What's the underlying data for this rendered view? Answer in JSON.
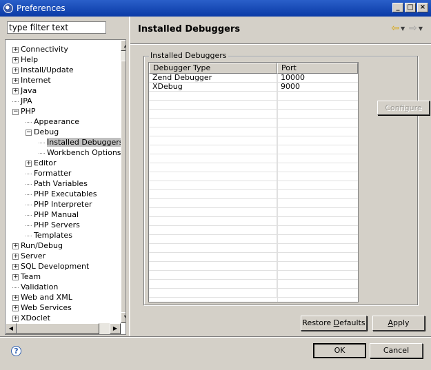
{
  "window": {
    "title": "Preferences"
  },
  "filter": {
    "value": "type filter text"
  },
  "tree": [
    {
      "label": "Connectivity",
      "expander": "+",
      "indent": 0
    },
    {
      "label": "Help",
      "expander": "+",
      "indent": 0
    },
    {
      "label": "Install/Update",
      "expander": "+",
      "indent": 0
    },
    {
      "label": "Internet",
      "expander": "+",
      "indent": 0
    },
    {
      "label": "Java",
      "expander": "+",
      "indent": 0
    },
    {
      "label": "JPA",
      "expander": "",
      "indent": 0
    },
    {
      "label": "PHP",
      "expander": "-",
      "indent": 0
    },
    {
      "label": "Appearance",
      "expander": "",
      "indent": 1
    },
    {
      "label": "Debug",
      "expander": "-",
      "indent": 1
    },
    {
      "label": "Installed Debuggers",
      "expander": "",
      "indent": 2,
      "selected": true
    },
    {
      "label": "Workbench Options",
      "expander": "",
      "indent": 2
    },
    {
      "label": "Editor",
      "expander": "+",
      "indent": 1
    },
    {
      "label": "Formatter",
      "expander": "",
      "indent": 1
    },
    {
      "label": "Path Variables",
      "expander": "",
      "indent": 1
    },
    {
      "label": "PHP Executables",
      "expander": "",
      "indent": 1
    },
    {
      "label": "PHP Interpreter",
      "expander": "",
      "indent": 1
    },
    {
      "label": "PHP Manual",
      "expander": "",
      "indent": 1
    },
    {
      "label": "PHP Servers",
      "expander": "",
      "indent": 1
    },
    {
      "label": "Templates",
      "expander": "",
      "indent": 1
    },
    {
      "label": "Run/Debug",
      "expander": "+",
      "indent": 0
    },
    {
      "label": "Server",
      "expander": "+",
      "indent": 0
    },
    {
      "label": "SQL Development",
      "expander": "+",
      "indent": 0
    },
    {
      "label": "Team",
      "expander": "+",
      "indent": 0
    },
    {
      "label": "Validation",
      "expander": "",
      "indent": 0
    },
    {
      "label": "Web and XML",
      "expander": "+",
      "indent": 0
    },
    {
      "label": "Web Services",
      "expander": "+",
      "indent": 0
    },
    {
      "label": "XDoclet",
      "expander": "+",
      "indent": 0
    }
  ],
  "page": {
    "title": "Installed Debuggers"
  },
  "group": {
    "legend": "Installed Debuggers"
  },
  "table": {
    "headers": [
      "Debugger Type",
      "Port"
    ],
    "rows": [
      [
        "Zend Debugger",
        "10000"
      ],
      [
        "XDebug",
        "9000"
      ]
    ],
    "empty_rows": 23
  },
  "buttons": {
    "configure": "Configure",
    "restore_defaults_pre": "Restore ",
    "restore_defaults_u": "D",
    "restore_defaults_post": "efaults",
    "apply_u": "A",
    "apply_post": "pply",
    "ok": "OK",
    "cancel": "Cancel"
  }
}
